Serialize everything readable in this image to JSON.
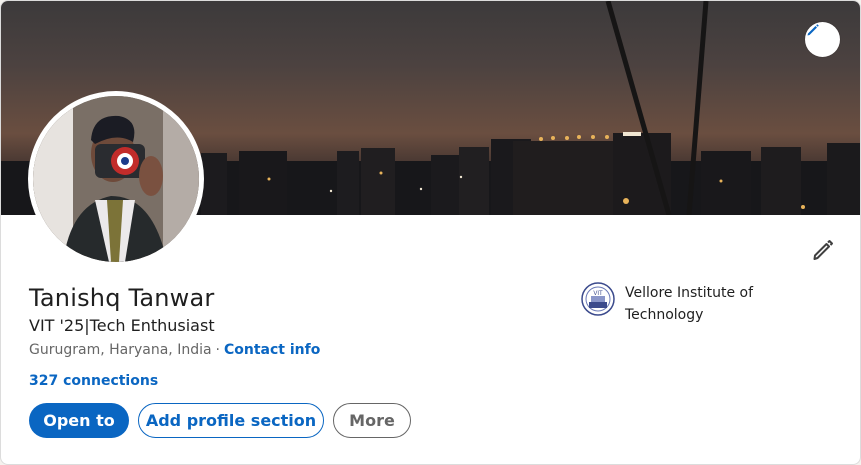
{
  "profile": {
    "name": "Tanishq Tanwar",
    "headline": "VIT '25|Tech Enthusiast",
    "location": "Gurugram, Haryana, India",
    "separator": "·",
    "contact_info_label": "Contact info",
    "connections_label": "327 connections"
  },
  "actions": {
    "open_to_label": "Open to",
    "add_section_label": "Add profile section",
    "more_label": "More"
  },
  "education": {
    "school_name": "Vellore Institute of Technology",
    "logo_text": "VIT"
  },
  "icons": {
    "banner_edit": "pencil-icon",
    "intro_edit": "pencil-icon"
  },
  "colors": {
    "accent": "#0a66c2",
    "text_primary": "#1f1f1f",
    "text_secondary": "#666666"
  }
}
